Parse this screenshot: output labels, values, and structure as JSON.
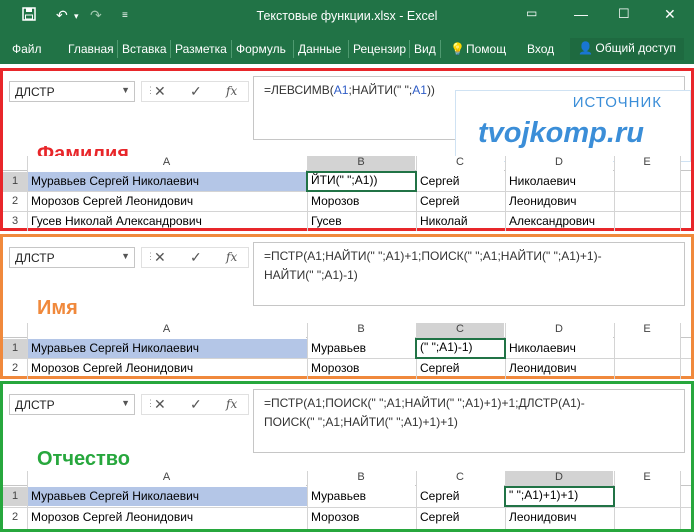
{
  "window": {
    "title": "Текстовые функции.xlsx - Excel",
    "brand_color": "#217346",
    "quick_access": [
      "save-icon",
      "undo-icon",
      "redo-icon",
      "customize-icon"
    ],
    "controls": [
      "ribbon-display-icon",
      "minimize-icon",
      "maximize-icon",
      "close-icon"
    ]
  },
  "ribbon": {
    "tabs": [
      "Файл",
      "Главная",
      "Вставка",
      "Разметка",
      "Формуль",
      "Данные",
      "Рецензир",
      "Вид"
    ],
    "help": "Помощ",
    "login": "Вход",
    "share": "Общий доступ"
  },
  "watermark": {
    "line1": "ИСТОЧНИК",
    "line2": "tvojkomp.ru"
  },
  "panels": [
    {
      "label": "Фамилия",
      "name_box": "ДЛСТР",
      "formula_text": "=ЛЕВСИМВ(A1;НАЙТИ(\" \";A1))",
      "formula_parts": [
        "=ЛЕВСИМВ(",
        "A1",
        ";НАЙТИ(\" \";",
        "A1",
        "))"
      ],
      "columns": [
        "A",
        "B",
        "C",
        "D",
        "E"
      ],
      "rows": [
        {
          "num": "1",
          "a": "Муравьев Сергей Николаевич",
          "b": "ЙТИ(\" \";A1))",
          "c": "Сергей",
          "d": "Николаевич"
        },
        {
          "num": "2",
          "a": "Морозов Сергей Леонидович",
          "b": "Морозов",
          "c": "Сергей",
          "d": "Леонидович"
        },
        {
          "num": "3",
          "a": "Гусев Николай Александрович",
          "b": "Гусев",
          "c": "Николай",
          "d": "Александрович"
        }
      ]
    },
    {
      "label": "Имя",
      "name_box": "ДЛСТР",
      "formula_line1": "=ПСТР(A1;НАЙТИ(\" \";A1)+1;ПОИСК(\" \";A1;НАЙТИ(\" \";A1)+1)-",
      "formula_line2": "НАЙТИ(\" \";A1)-1)",
      "columns": [
        "A",
        "B",
        "C",
        "D",
        "E"
      ],
      "rows": [
        {
          "num": "1",
          "a": "Муравьев Сергей Николаевич",
          "b": "Муравьев",
          "c": "(\" \";A1)-1)",
          "d": "Николаевич"
        },
        {
          "num": "2",
          "a": "Морозов Сергей Леонидович",
          "b": "Морозов",
          "c": "Сергей",
          "d": "Леонидович"
        }
      ]
    },
    {
      "label": "Отчество",
      "name_box": "ДЛСТР",
      "formula_line1": "=ПСТР(A1;ПОИСК(\" \";A1;НАЙТИ(\" \";A1)+1)+1;ДЛСТР(A1)-",
      "formula_line2": "ПОИСК(\" \";A1;НАЙТИ(\" \";A1)+1)+1)",
      "columns": [
        "A",
        "B",
        "C",
        "D",
        "E"
      ],
      "rows": [
        {
          "num": "1",
          "a": "Муравьев Сергей Николаевич",
          "b": "Муравьев",
          "c": "Сергей",
          "d": "\" \";A1)+1)+1)"
        },
        {
          "num": "2",
          "a": "Морозов Сергей Леонидович",
          "b": "Морозов",
          "c": "Сергей",
          "d": "Леонидович"
        }
      ]
    }
  ]
}
